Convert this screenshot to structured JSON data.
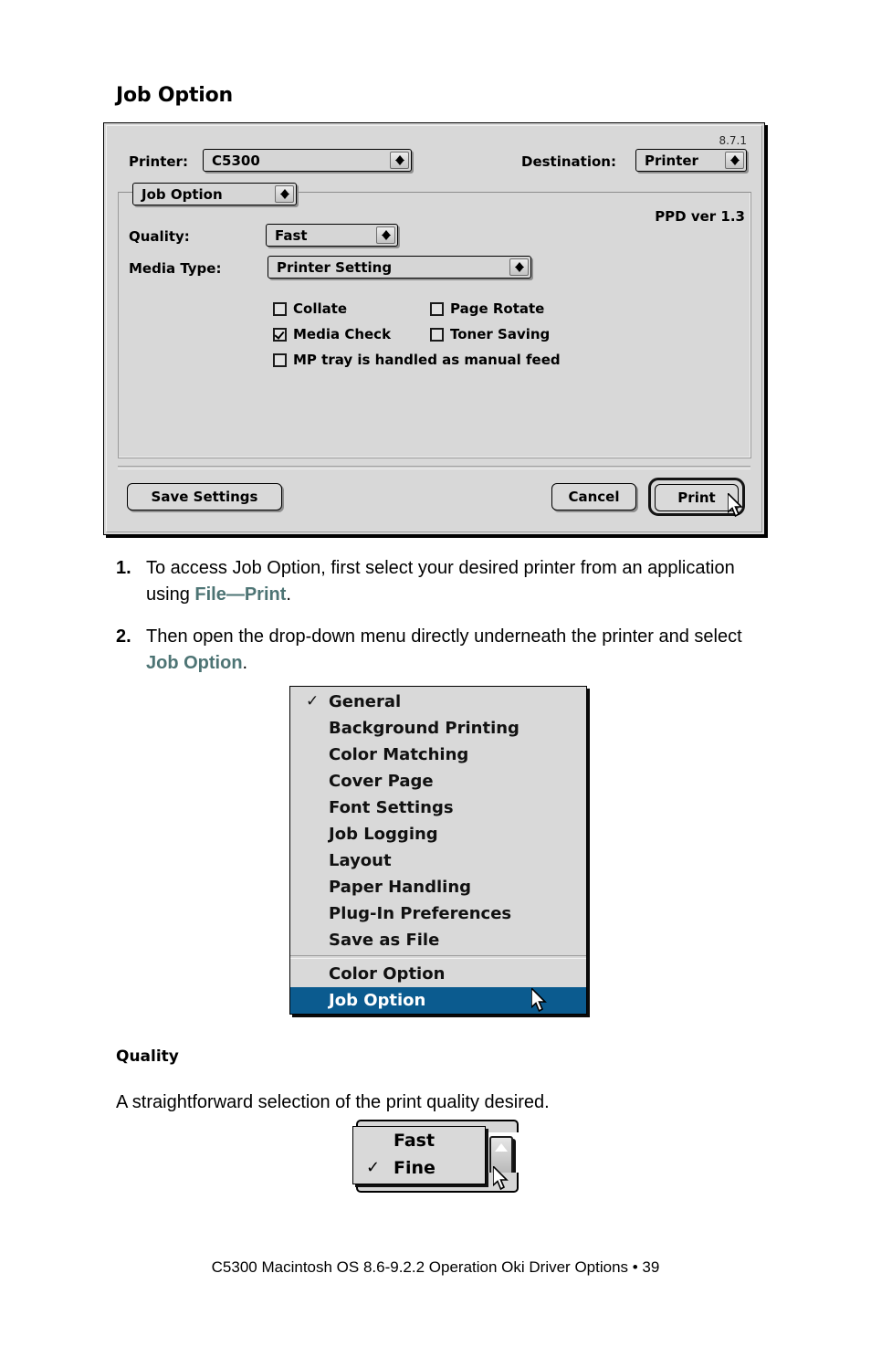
{
  "page": {
    "section_title": "Job Option",
    "sub_title": "Quality",
    "quality_desc": "A straightforward selection of the print quality desired.",
    "footer": "C5300 Macintosh OS 8.6-9.2.2 Operation Oki Driver Options • 39",
    "highlight_color": "#4d7474"
  },
  "steps": [
    {
      "num": "1.",
      "text_before": "To access Job Option, first select your desired printer from an application using ",
      "highlight": "File—Print",
      "text_after": "."
    },
    {
      "num": "2.",
      "text_before": "Then open the drop-down menu directly underneath the printer and select ",
      "highlight": "Job Option",
      "text_after": "."
    }
  ],
  "dialog": {
    "version": "8.7.1",
    "ppd_version": "PPD ver 1.3",
    "printer_label": "Printer:",
    "printer_value": "C5300",
    "destination_label": "Destination:",
    "destination_value": "Printer",
    "pane_value": "Job Option",
    "quality_label": "Quality:",
    "quality_value": "Fast",
    "media_type_label": "Media Type:",
    "media_type_value": "Printer Setting",
    "checkboxes": [
      {
        "label": "Collate",
        "checked": false
      },
      {
        "label": "Page Rotate",
        "checked": false
      },
      {
        "label": "Media Check",
        "checked": true
      },
      {
        "label": "Toner Saving",
        "checked": false
      },
      {
        "label": "MP tray is handled as manual feed",
        "checked": false
      }
    ],
    "save_settings_label": "Save Settings",
    "cancel_label": "Cancel",
    "print_label": "Print"
  },
  "menu": {
    "items": [
      {
        "label": "General",
        "checked": true,
        "selected": false,
        "divider_before": false
      },
      {
        "label": "Background Printing",
        "checked": false,
        "selected": false,
        "divider_before": false
      },
      {
        "label": "Color Matching",
        "checked": false,
        "selected": false,
        "divider_before": false
      },
      {
        "label": "Cover Page",
        "checked": false,
        "selected": false,
        "divider_before": false
      },
      {
        "label": "Font Settings",
        "checked": false,
        "selected": false,
        "divider_before": false
      },
      {
        "label": "Job Logging",
        "checked": false,
        "selected": false,
        "divider_before": false
      },
      {
        "label": "Layout",
        "checked": false,
        "selected": false,
        "divider_before": false
      },
      {
        "label": "Paper Handling",
        "checked": false,
        "selected": false,
        "divider_before": false
      },
      {
        "label": "Plug-In Preferences",
        "checked": false,
        "selected": false,
        "divider_before": false
      },
      {
        "label": "Save as File",
        "checked": false,
        "selected": false,
        "divider_before": false
      },
      {
        "label": "Color Option",
        "checked": false,
        "selected": false,
        "divider_before": true
      },
      {
        "label": "Job Option",
        "checked": false,
        "selected": true,
        "divider_before": false
      }
    ],
    "selected_color": "#0b5b8f",
    "check_glyph": "✓"
  },
  "quality_menu": {
    "items": [
      {
        "label": "Fast",
        "checked": false
      },
      {
        "label": "Fine",
        "checked": true
      }
    ],
    "check_glyph": "✓"
  }
}
